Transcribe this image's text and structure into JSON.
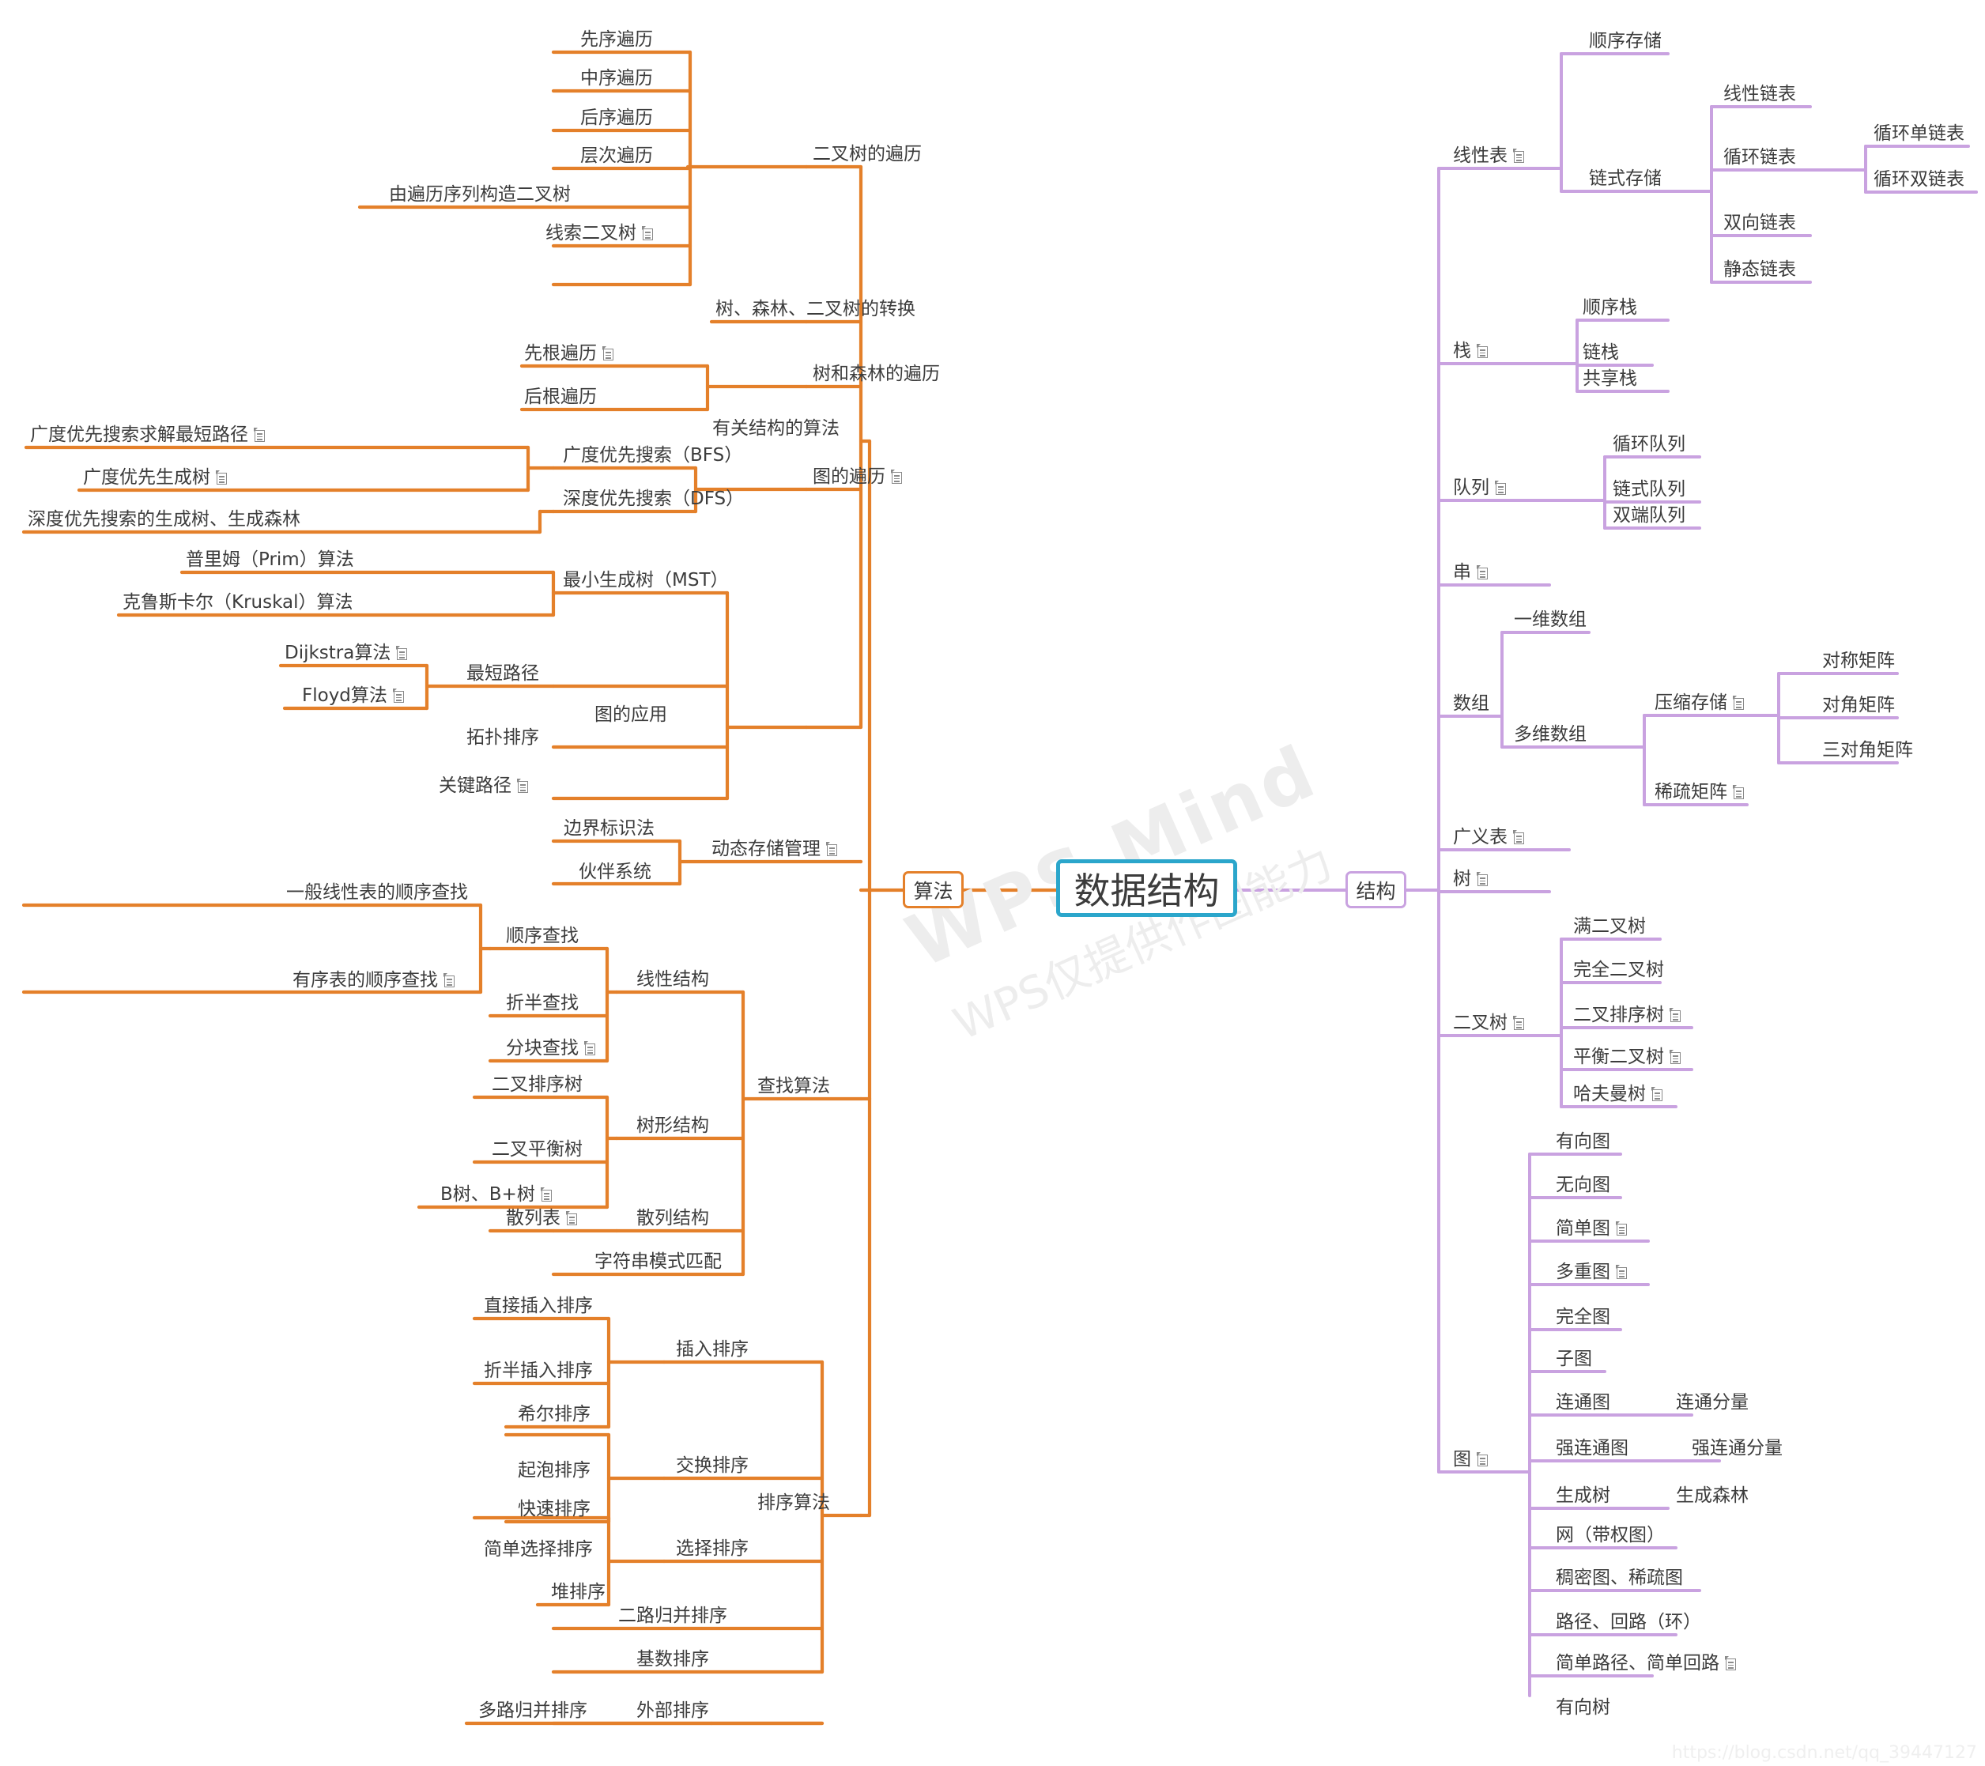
{
  "meta": {
    "root": "数据结构",
    "left_root": "算法",
    "right_root": "结构",
    "watermark_line1": "WPS Mind",
    "watermark_line2": "WPS仅提供作图能力",
    "source_url": "https://blog.csdn.net/qq_39447127",
    "accent_orange": "#e4802a",
    "accent_purple": "#c9a2e0",
    "accent_blue": "#2ba6cb",
    "note_icon": "note-icon"
  },
  "nodes": {
    "n_xianxu": "先序遍历",
    "n_zhongxu": "中序遍历",
    "n_houxu": "后序遍历",
    "n_cengci": "层次遍历",
    "n_goujian": "由遍历序列构造二叉树",
    "n_xiansuo": "线索二叉树",
    "n_ecs_bianli": "二叉树的遍历",
    "n_zhuanhuan": "树、森林、二叉树的转换",
    "n_xiangen": "先根遍历",
    "n_hougen": "后根遍历",
    "n_shulin_bianli": "树和森林的遍历",
    "n_bfs_short": "广度优先搜索求解最短路径",
    "n_bfs_tree": "广度优先生成树",
    "n_bfs": "广度优先搜索（BFS）",
    "n_dfs_forest": "深度优先搜索的生成树、生成森林",
    "n_dfs": "深度优先搜索（DFS）",
    "n_tu_bianli": "图的遍历",
    "n_prim": "普里姆（Prim）算法",
    "n_kruskal": "克鲁斯卡尔（Kruskal）算法",
    "n_mst": "最小生成树（MST）",
    "n_dijkstra": "Dijkstra算法",
    "n_floyd": "Floyd算法",
    "n_shortest": "最短路径",
    "n_topo": "拓扑排序",
    "n_critical": "关键路径",
    "n_tu_app": "图的应用",
    "n_struct_alg": "有关结构的算法",
    "n_boundary": "边界标识法",
    "n_buddy": "伙伴系统",
    "n_dynmem": "动态存储管理",
    "n_seq_general": "一般线性表的顺序查找",
    "n_seq_sorted": "有序表的顺序查找",
    "n_seq_search": "顺序查找",
    "n_binary_search": "折半查找",
    "n_block_search": "分块查找",
    "n_linear_struct": "线性结构",
    "n_bst": "二叉排序树",
    "n_avl": "二叉平衡树",
    "n_btree": "B树、B+树",
    "n_tree_struct": "树形结构",
    "n_hashtable": "散列表",
    "n_hash_struct": "散列结构",
    "n_strmatch": "字符串模式匹配",
    "n_search_alg": "查找算法",
    "n_insert_direct": "直接插入排序",
    "n_insert_binary": "折半插入排序",
    "n_shell": "希尔排序",
    "n_insert_sort": "插入排序",
    "n_bubble": "起泡排序",
    "n_quick": "快速排序",
    "n_swap_sort": "交换排序",
    "n_select_simple": "简单选择排序",
    "n_heap": "堆排序",
    "n_select_sort": "选择排序",
    "n_merge2": "二路归并排序",
    "n_radix": "基数排序",
    "n_multi_merge": "多路归并排序",
    "n_external": "外部排序",
    "n_sort_alg": "排序算法",
    "n_seq_store": "顺序存储",
    "n_linear_link": "线性链表",
    "n_circ_single": "循环单链表",
    "n_circ_double": "循环双链表",
    "n_circ_link": "循环链表",
    "n_double_link": "双向链表",
    "n_static_link": "静态链表",
    "n_link_store": "链式存储",
    "n_linear_list": "线性表",
    "n_seq_stack": "顺序栈",
    "n_link_stack": "链栈",
    "n_share_stack": "共享栈",
    "n_stack": "栈",
    "n_circ_queue": "循环队列",
    "n_link_queue": "链式队列",
    "n_deque": "双端队列",
    "n_queue": "队列",
    "n_string": "串",
    "n_arr1d": "一维数组",
    "n_sym_matrix": "对称矩阵",
    "n_diag_matrix": "对角矩阵",
    "n_tridiag_matrix": "三对角矩阵",
    "n_compress": "压缩存储",
    "n_sparse": "稀疏矩阵",
    "n_arrnd": "多维数组",
    "n_array": "数组",
    "n_genlist": "广义表",
    "n_tree": "树",
    "n_full_bt": "满二叉树",
    "n_complete_bt": "完全二叉树",
    "n_bst2": "二叉排序树",
    "n_balanced_bt": "平衡二叉树",
    "n_huffman": "哈夫曼树",
    "n_bintree": "二叉树",
    "n_digraph": "有向图",
    "n_undigraph": "无向图",
    "n_simple_graph": "简单图",
    "n_multi_graph": "多重图",
    "n_complete_graph": "完全图",
    "n_subgraph": "子图",
    "n_connected": "连通图",
    "n_connected_comp": "连通分量",
    "n_strong_conn": "强连通图",
    "n_strong_comp": "强连通分量",
    "n_span_tree": "生成树",
    "n_span_forest": "生成森林",
    "n_network": "网（带权图）",
    "n_dense_sparse": "稠密图、稀疏图",
    "n_path_cycle": "路径、回路（环）",
    "n_simple_path": "简单路径、简单回路",
    "n_dir_tree": "有向树",
    "n_graph": "图"
  }
}
